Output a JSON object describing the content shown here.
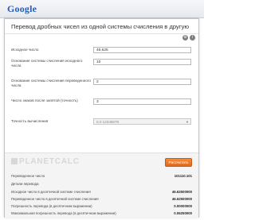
{
  "browser": {
    "logo": "Google"
  },
  "calculator": {
    "title": "Перевод дробных чисел из одной системы счисления в другую",
    "icons": [
      "settings-icon",
      "info-icon"
    ],
    "fields": {
      "source_number": {
        "label": "Исходное число",
        "value": "46,625"
      },
      "source_base": {
        "label": "Основание системы счисления исходного числа",
        "value": "10"
      },
      "target_base": {
        "label": "Основание системы счисления переведенного числа",
        "value": "2"
      },
      "fraction_digits": {
        "label": "Число знаков после запятой (точность)",
        "value": "3"
      },
      "precision": {
        "label": "Точность вычисления",
        "value": "0.0 12345678"
      }
    },
    "brand": "PLANETCALC",
    "calculate_label": "Рассчитать",
    "results": {
      "converted": {
        "label": "Переведенное число",
        "value": "101110.101"
      },
      "details_heading": "Детали перевода",
      "rows": [
        {
          "label": "Исходное число в десятичной системе счисления",
          "value": "46.62500000"
        },
        {
          "label": "Переведенное число в десятичной системе счисления",
          "value": "46.62500000"
        },
        {
          "label": "Погрешность перевода (в десятичном выражении)",
          "value": "0.00000000"
        },
        {
          "label": "Максимальная погрешность перевода (в десятичном выражении)",
          "value": "0.06250000"
        }
      ]
    }
  },
  "colors": {
    "accent": "#e8792a",
    "link": "#2a5db0"
  }
}
